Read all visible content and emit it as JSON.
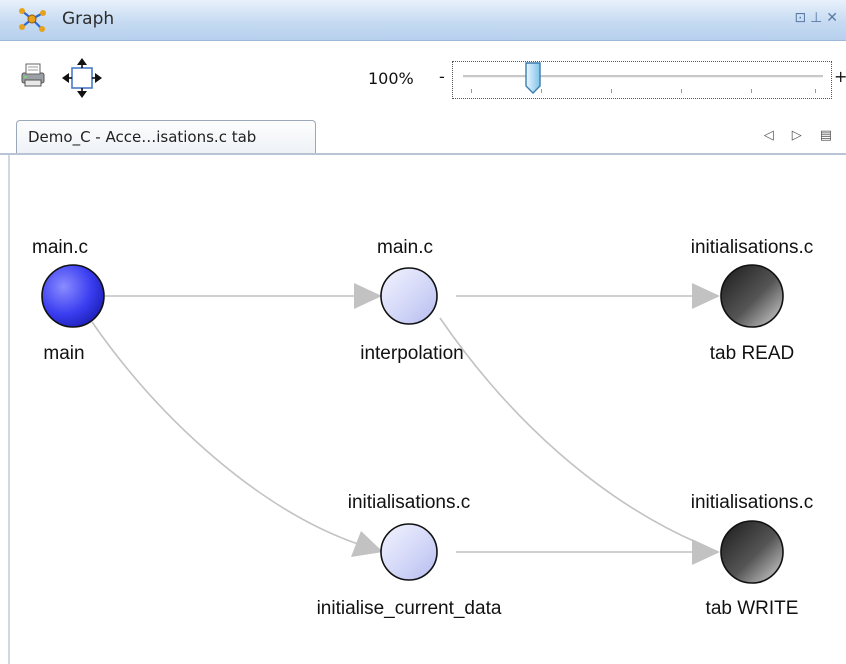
{
  "window": {
    "title": "Graph",
    "title_icon": "graph-network-icon",
    "controls": [
      "⊡",
      "⊥",
      "✕"
    ]
  },
  "toolbar": {
    "print_icon": "printer-icon",
    "move_icon": "move-arrows-icon",
    "zoom_label": "100%",
    "zoom_minus": "-",
    "zoom_plus": "+",
    "zoom_level_fraction": 0.2
  },
  "tabs": {
    "active_label": "Demo_C - Acce…isations.c tab",
    "nav": [
      "◁",
      "▷",
      "▤"
    ]
  },
  "graph": {
    "nodes": [
      {
        "id": "n1",
        "file": "main.c",
        "name": "main",
        "style": "blue"
      },
      {
        "id": "n2",
        "file": "main.c",
        "name": "interpolation",
        "style": "light"
      },
      {
        "id": "n3",
        "file": "initialisations.c",
        "name": "tab READ",
        "style": "dark"
      },
      {
        "id": "n4",
        "file": "initialisations.c",
        "name": "initialise_current_data",
        "style": "light"
      },
      {
        "id": "n5",
        "file": "initialisations.c",
        "name": "tab WRITE",
        "style": "dark"
      }
    ],
    "edges": [
      {
        "from": "n1",
        "to": "n2"
      },
      {
        "from": "n2",
        "to": "n3"
      },
      {
        "from": "n1",
        "to": "n4"
      },
      {
        "from": "n4",
        "to": "n5"
      },
      {
        "from": "n2",
        "to": "n5"
      }
    ]
  },
  "colors": {
    "edge": "#c2c2c2",
    "node_blue": "#3a3df0",
    "node_light": "#d6daf8",
    "node_dark": "#333333"
  }
}
